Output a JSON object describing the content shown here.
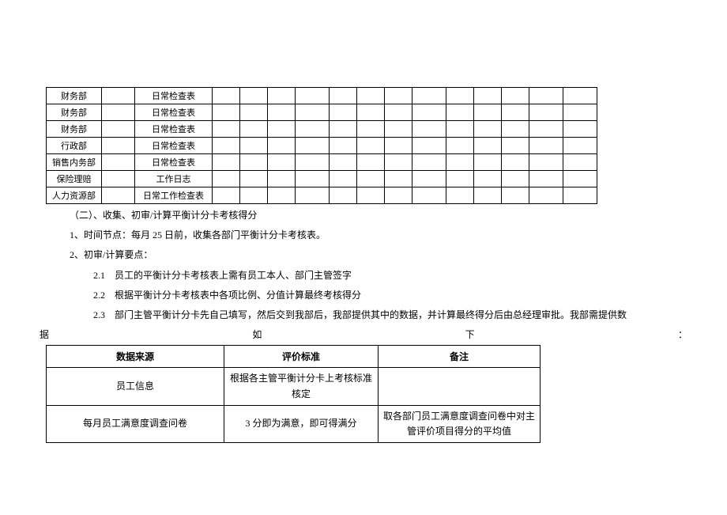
{
  "table1": {
    "rows": [
      {
        "dept": "财务部",
        "type": "日常检查表"
      },
      {
        "dept": "财务部",
        "type": "日常检查表"
      },
      {
        "dept": "财务部",
        "type": "日常检查表"
      },
      {
        "dept": "行政部",
        "type": "日常检查表"
      },
      {
        "dept": "销售内务部",
        "type": "日常检查表"
      },
      {
        "dept": "保险理赔",
        "type": "工作日志"
      },
      {
        "dept": "人力资源部",
        "type": "日常工作检查表"
      }
    ]
  },
  "section": {
    "heading": "（二）、收集、初审/计算平衡计分卡考核得分",
    "line1": "1、时间节点：每月 25 日前，收集各部门平衡计分卡考核表。",
    "line2": "2、初审/计算要点：",
    "p21": "2.1　员工的平衡计分卡考核表上需有员工本人、部门主管签字",
    "p22": "2.2　根据平衡计分卡考核表中各项比例、分值计算最终考核得分",
    "p23": "2.3　部门主管平衡计分卡先自己填写，然后交到我部后，我部提供其中的数据，并计算最终得分后由总经理审批。我部需提供数",
    "spread_left": "据",
    "spread_mid": "如",
    "spread_right": "下",
    "spread_colon": "："
  },
  "table2": {
    "headers": {
      "c1": "数据来源",
      "c2": "评价标准",
      "c3": "备注"
    },
    "rows": [
      {
        "c1": "员工信息",
        "c2": "根据各主管平衡计分卡上考核标准核定",
        "c3": ""
      },
      {
        "c1": "每月员工满意度调查问卷",
        "c2": "3 分即为满意，即可得满分",
        "c3": "取各部门员工满意度调查问卷中对主管评价项目得分的平均值"
      }
    ]
  }
}
